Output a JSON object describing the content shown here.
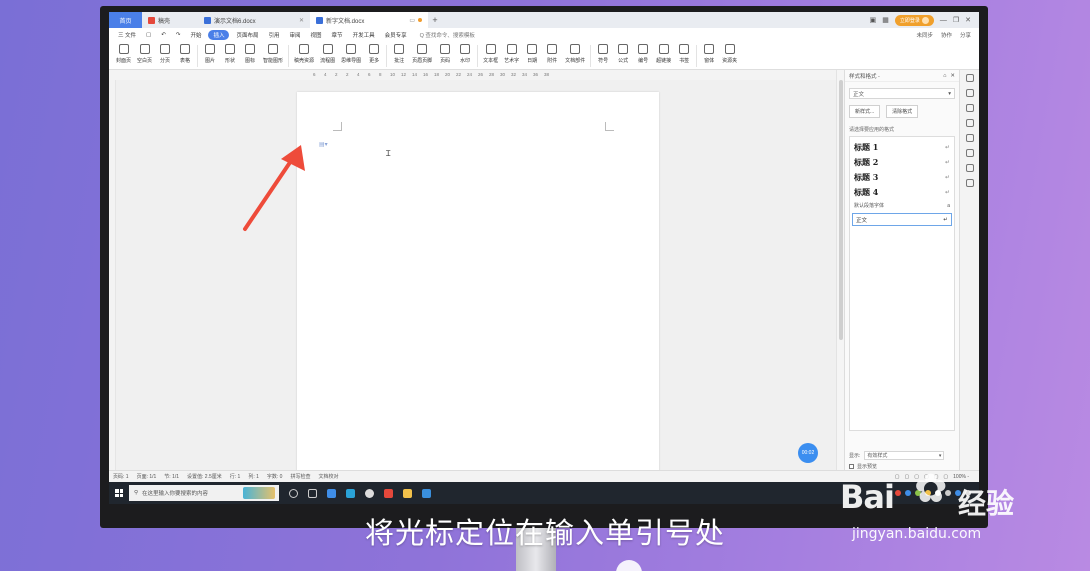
{
  "tabs": [
    {
      "label": "首页"
    },
    {
      "label": "稿壳"
    },
    {
      "label": "演示文档6.docx"
    },
    {
      "label": "新字文档.docx"
    }
  ],
  "login_label": "立即登录",
  "menu": {
    "file": "三 文件",
    "items": [
      "开始",
      "插入",
      "页面布局",
      "引用",
      "审阅",
      "视图",
      "章节",
      "开发工具",
      "会员专享"
    ],
    "active": "插入",
    "search": "Q 查找命令、搜索模板",
    "right": [
      "未同步",
      "协作",
      "分享"
    ]
  },
  "ribbon": [
    "封面页",
    "空白页",
    "分页",
    "表格",
    "图片",
    "形状",
    "图标",
    "智能图形",
    "稿壳资源",
    "流程图",
    "思维导图",
    "更多",
    "批注",
    "页眉页脚",
    "页码",
    "水印",
    "文本框",
    "艺术字",
    "日期",
    "附件",
    "文档部件",
    "符号",
    "公式",
    "编号",
    "超链接",
    "书签",
    "窗体",
    "资源夹"
  ],
  "ruler_numbers": [
    "6",
    "4",
    "2",
    "2",
    "4",
    "6",
    "8",
    "10",
    "12",
    "14",
    "16",
    "18",
    "20",
    "22",
    "24",
    "26",
    "28",
    "30",
    "32",
    "34",
    "36",
    "38"
  ],
  "panel": {
    "title": "样式和格式 -",
    "current": "正文",
    "new_style": "新样式...",
    "clear_format": "清除格式",
    "choose_label": "请选择要应用的格式",
    "styles": [
      "标题 1",
      "标题 2",
      "标题 3",
      "标题 4"
    ],
    "default_font": "默认段落字体",
    "normal": "正文",
    "show_label": "显示:",
    "show_value": "有效样式",
    "preview_label": "显示预览"
  },
  "timer": "00:02",
  "status": [
    "页码: 1",
    "页面: 1/1",
    "节: 1/1",
    "设置值: 2.5厘米",
    "行: 1",
    "列: 1",
    "字数: 0",
    "拼写检查",
    "文档校对"
  ],
  "zoom": "100% -",
  "taskbar": {
    "search_placeholder": "在这里输入你要搜索的内容"
  },
  "subtitle": "将光标定位在输入单引号处",
  "watermark": {
    "brand": "Bai",
    "brand_cn": "经验",
    "url": "jingyan.baidu.com"
  }
}
